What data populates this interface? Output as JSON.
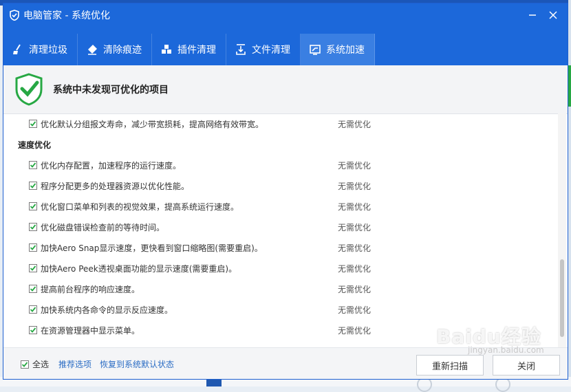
{
  "window": {
    "title": "电脑管家 - 系统优化"
  },
  "tabs": [
    {
      "label": "清理垃圾",
      "icon": "broom-icon",
      "active": false
    },
    {
      "label": "清除痕迹",
      "icon": "eraser-icon",
      "active": false
    },
    {
      "label": "插件清理",
      "icon": "plugin-icon",
      "active": false
    },
    {
      "label": "文件清理",
      "icon": "file-clean-icon",
      "active": false
    },
    {
      "label": "系统加速",
      "icon": "speedup-icon",
      "active": true
    }
  ],
  "status": {
    "message": "系统中未发现可优化的项目",
    "icon": "shield-check-icon"
  },
  "list": {
    "top_item": {
      "label": "优化默认分组报文寿命，减少带宽损耗，提高网络有效带宽。",
      "status": "无需优化",
      "checked": true
    },
    "section": "速度优化",
    "items": [
      {
        "label": "优化内存配置，加速程序的运行速度。",
        "status": "无需优化",
        "checked": true
      },
      {
        "label": "程序分配更多的处理器资源以优化性能。",
        "status": "无需优化",
        "checked": true
      },
      {
        "label": "优化窗口菜单和列表的视觉效果，提高系统运行速度。",
        "status": "无需优化",
        "checked": true
      },
      {
        "label": "优化磁盘错误检查前的等待时间。",
        "status": "无需优化",
        "checked": true
      },
      {
        "label": "加快Aero Snap显示速度，更快看到窗口缩略图(需要重启)。",
        "status": "无需优化",
        "checked": true
      },
      {
        "label": "加快Aero Peek透视桌面功能的显示速度(需要重启)。",
        "status": "无需优化",
        "checked": true
      },
      {
        "label": "提高前台程序的响应速度。",
        "status": "无需优化",
        "checked": true
      },
      {
        "label": "加快系统内各命令的显示反应速度。",
        "status": "无需优化",
        "checked": true
      },
      {
        "label": "在资源管理器中显示菜单。",
        "status": "无需优化",
        "checked": true
      }
    ]
  },
  "footer": {
    "select_all": "全选",
    "recommended": "推荐选项",
    "restore_default": "恢复到系统默认状态",
    "rescan": "重新扫描",
    "close": "关闭"
  },
  "watermark": {
    "main": "Baidu经验",
    "sub": "jingyan.baidu.com"
  },
  "colors": {
    "title_bar": "#1c68da",
    "active_tab": "#3a7fe2",
    "check": "#27a844",
    "link": "#2a6cc4"
  }
}
